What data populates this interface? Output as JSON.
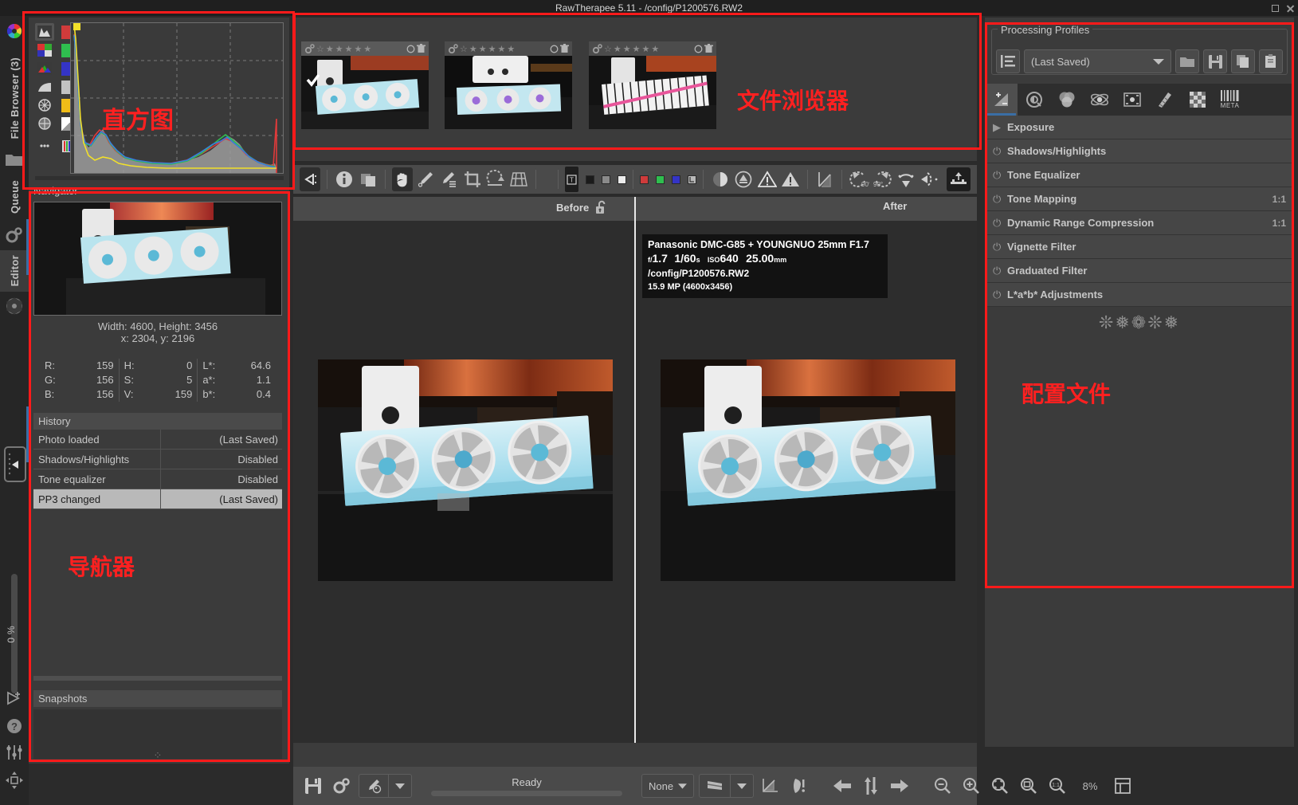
{
  "window": {
    "title": "RawTherapee 5.11 - /config/P1200576.RW2"
  },
  "rail": {
    "file_browser": "File Browser (3)",
    "queue": "Queue",
    "editor": "Editor",
    "zoom_vertical": "0 %"
  },
  "histogram": {
    "annotation": "直方图",
    "mode_buttons": [
      "histogram-icon",
      "rgb-icon",
      "raw-icon",
      "luminance-icon",
      "chroma-icon",
      "bw-icon",
      "more-icon"
    ],
    "channel_swatches": [
      "#cf3b3b",
      "#2fbe4f",
      "#3434c6",
      "#c0c0c0",
      "#f2bb17",
      "#d9d9d9",
      "#rgbbar"
    ]
  },
  "navigator": {
    "title": "Navigator",
    "dimensions": "Width: 4600, Height: 3456",
    "cursor": "x: 2304, y: 2196",
    "annotation": "导航器",
    "values": [
      {
        "label": "R:",
        "value": "159"
      },
      {
        "label": "G:",
        "value": "156"
      },
      {
        "label": "B:",
        "value": "156"
      },
      {
        "label": "H:",
        "value": "0"
      },
      {
        "label": "S:",
        "value": "5"
      },
      {
        "label": "V:",
        "value": "159"
      },
      {
        "label": "L*:",
        "value": "64.6"
      },
      {
        "label": "a*:",
        "value": "1.1"
      },
      {
        "label": "b*:",
        "value": "0.4"
      }
    ]
  },
  "history": {
    "title": "History",
    "rows": [
      {
        "name": "Photo loaded",
        "value": "(Last Saved)",
        "selected": false
      },
      {
        "name": "Shadows/Highlights",
        "value": "Disabled",
        "selected": false
      },
      {
        "name": "Tone equalizer",
        "value": "Disabled",
        "selected": false
      },
      {
        "name": "PP3 changed",
        "value": "(Last Saved)",
        "selected": true
      }
    ]
  },
  "snapshots": {
    "title": "Snapshots"
  },
  "filmstrip": {
    "annotation": "文件浏览器",
    "thumbnails": [
      {
        "rank_stars": 5,
        "selected": true
      },
      {
        "rank_stars": 5,
        "selected": false
      },
      {
        "rank_stars": 5,
        "selected": false
      }
    ]
  },
  "toolbar": {
    "left_tools": [
      "panel-toggle-icon",
      "info-icon",
      "before-after-icon",
      "hand-icon",
      "color-picker-icon",
      "multi-picker-icon",
      "crop-icon",
      "straighten-icon",
      "perspective-icon"
    ],
    "background_swatches": [
      "#1b1b1b",
      "#808080",
      "#e9e9e9"
    ],
    "channel_buttons": [
      "#cf3b3b",
      "#2fbe4f",
      "#3434c6",
      "#b9b9b9"
    ],
    "right_tools": [
      "gamut-icon",
      "indicate-clipping-icon",
      "shadow-clip-icon",
      "highlight-clip-icon",
      "curve-icon",
      "rotate-left-90-icon",
      "rotate-right-90-icon",
      "flip-vertical-icon",
      "flip-horizontal-icon",
      "send-to-editor-icon"
    ]
  },
  "preview": {
    "before_label": "Before",
    "after_label": "After",
    "lock_icon": "unlock-icon",
    "metadata": {
      "camera": "Panasonic DMC-G85 + YOUNGNUO 25mm F1.7",
      "aperture_prefix": "f/",
      "aperture": "1.7",
      "shutter": "1/60",
      "shutter_unit": "s",
      "iso_prefix": "ISO",
      "iso": "640",
      "focal": "25.00",
      "focal_unit": "mm",
      "path": "/config/P1200576.RW2",
      "size": "15.9 MP (4600x3456)"
    }
  },
  "statusbar": {
    "ready_text": "Ready",
    "queue_label": "None",
    "zoom_level": "8%",
    "buttons": [
      "save-icon",
      "preferences-icon",
      "color-picker-dropdown-icon",
      "queue-dropdown-icon",
      "histogram-curve-icon",
      "soft-proof-icon",
      "previous-image-icon",
      "sync-icon",
      "next-image-icon",
      "zoom-out-icon",
      "zoom-in-icon",
      "zoom-to-fit-icon",
      "zoom-to-crop-icon",
      "zoom-100-icon",
      "fullscreen-icon"
    ]
  },
  "processing_profiles": {
    "title": "Processing Profiles",
    "annotation": "配置文件",
    "selected_profile": "(Last Saved)",
    "buttons": [
      "profile-list-icon",
      "load-profile-icon",
      "save-profile-icon",
      "copy-profile-icon",
      "paste-profile-icon"
    ],
    "tabs": [
      "exposure-tab-icon",
      "detail-tab-icon",
      "color-tab-icon",
      "advanced-tab-icon",
      "transform-tab-icon",
      "raw-tab-icon",
      "effects-tab-icon",
      "metadata-tab-icon"
    ],
    "metadata_tab_label": "META",
    "tools": [
      {
        "label": "Exposure",
        "prefix": "expand-arrow-icon",
        "badge": ""
      },
      {
        "label": "Shadows/Highlights",
        "prefix": "power-icon",
        "badge": ""
      },
      {
        "label": "Tone Equalizer",
        "prefix": "power-icon",
        "badge": ""
      },
      {
        "label": "Tone Mapping",
        "prefix": "power-icon",
        "badge": "1:1"
      },
      {
        "label": "Dynamic Range Compression",
        "prefix": "power-icon",
        "badge": "1:1"
      },
      {
        "label": "Vignette Filter",
        "prefix": "power-icon",
        "badge": ""
      },
      {
        "label": "Graduated Filter",
        "prefix": "power-icon",
        "badge": ""
      },
      {
        "label": "L*a*b* Adjustments",
        "prefix": "power-icon",
        "badge": ""
      }
    ],
    "decoration": "❊❅❁❊❅"
  }
}
